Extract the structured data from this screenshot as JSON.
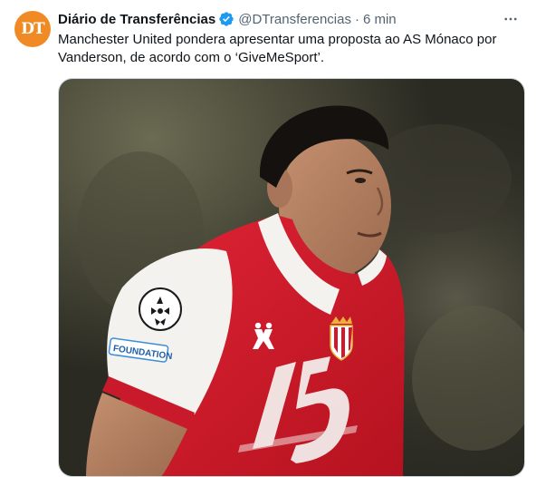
{
  "tweet": {
    "avatar_initials": "DT",
    "author_name": "Diário de Transferências",
    "handle": "@DTransferencias",
    "separator": "·",
    "time": "6 min",
    "text": "Manchester United pondera apresentar uma proposta ao AS Mónaco por Vanderson, de acordo com o ‘GiveMeSport’.",
    "verified_icon": "verified-badge-icon",
    "more_icon": "more-options-icon"
  },
  "media": {
    "sleeve_patch_text": "FOUNDATION",
    "colors": {
      "shirt_red": "#d3182b",
      "avatar_orange": "#f08a24",
      "verified_blue": "#1d9bf0"
    }
  }
}
